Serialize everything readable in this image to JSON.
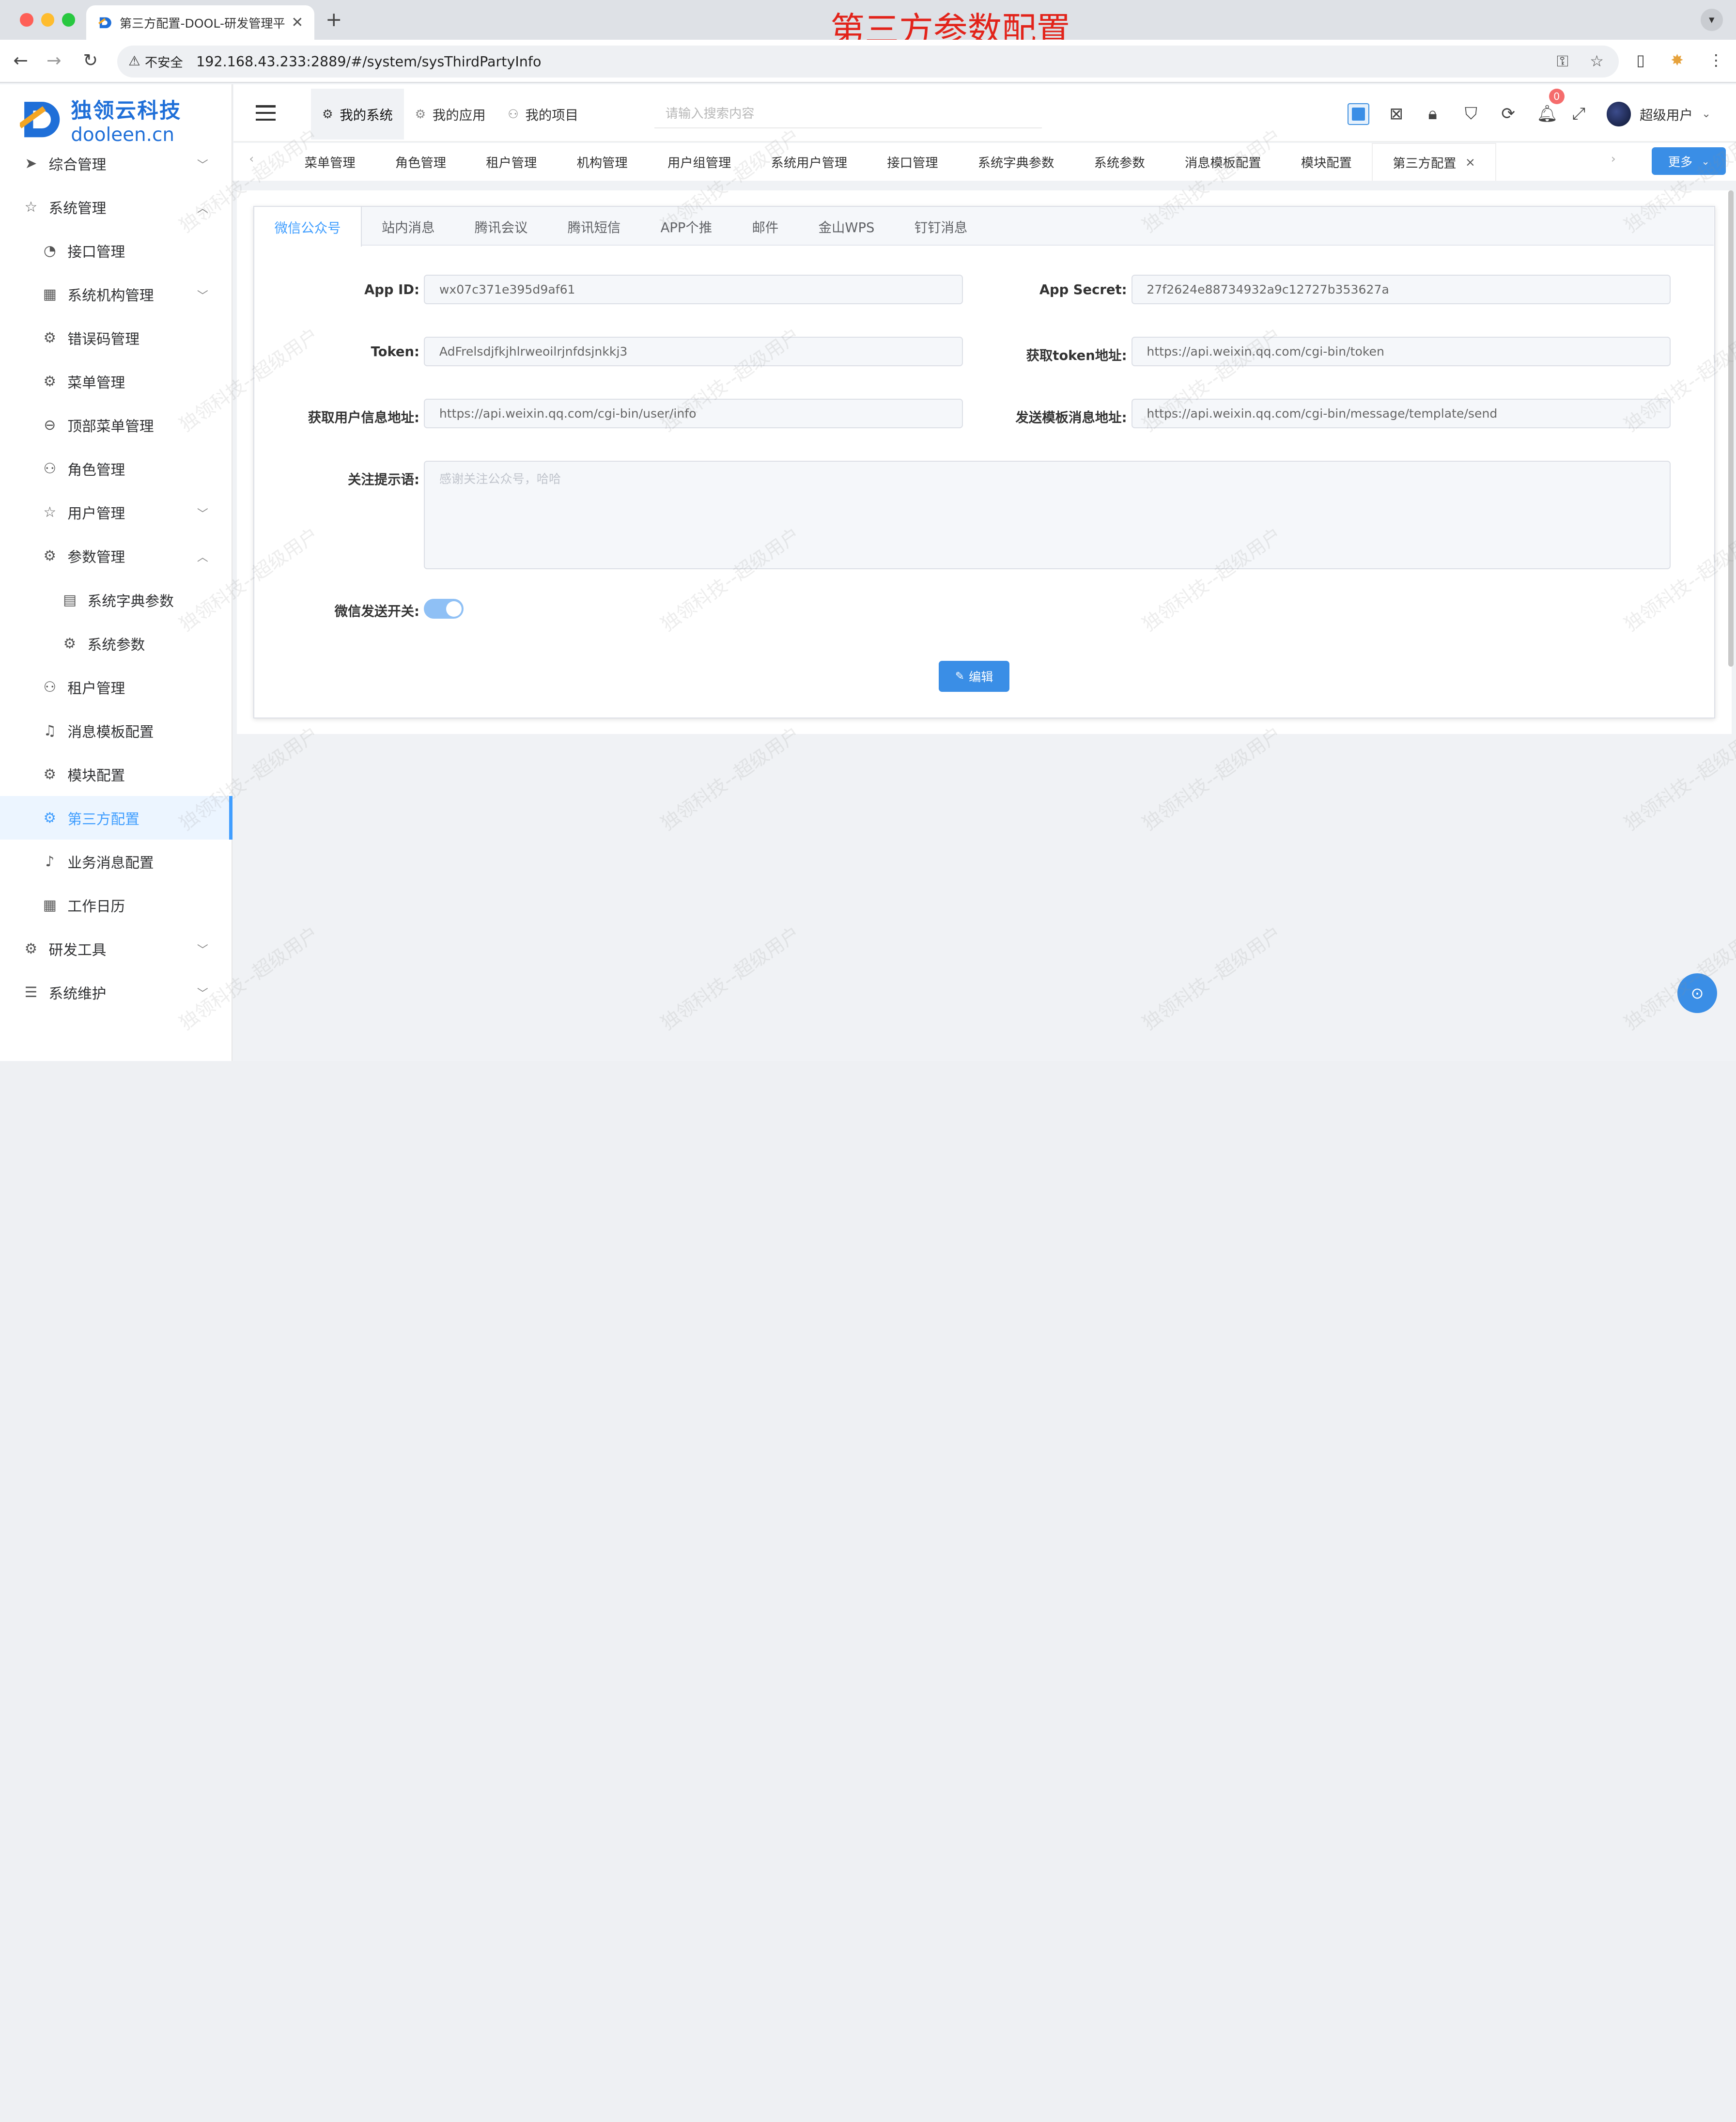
{
  "overlay_title": "第三方参数配置",
  "browser": {
    "tab_title": "第三方配置-DOOL-研发管理平",
    "security_label": "不安全",
    "url": "192.168.43.233:2889/#/system/sysThirdPartyInfo"
  },
  "logo": {
    "cn": "独领云科技",
    "en": "dooleen.cn"
  },
  "sidebar": {
    "items": [
      {
        "label": "综合管理",
        "icon": "send-icon",
        "level": 1,
        "arrow": "down"
      },
      {
        "label": "系统管理",
        "icon": "star-icon",
        "level": 1,
        "arrow": "up"
      },
      {
        "label": "接口管理",
        "icon": "gauge-icon",
        "level": 2
      },
      {
        "label": "系统机构管理",
        "icon": "grid-icon",
        "level": 2,
        "arrow": "down"
      },
      {
        "label": "错误码管理",
        "icon": "gear-icon",
        "level": 2
      },
      {
        "label": "菜单管理",
        "icon": "settings-icon",
        "level": 2
      },
      {
        "label": "顶部菜单管理",
        "icon": "zoom-out-icon",
        "level": 2
      },
      {
        "label": "角色管理",
        "icon": "user-icon",
        "level": 2
      },
      {
        "label": "用户管理",
        "icon": "star-icon",
        "level": 2,
        "arrow": "down"
      },
      {
        "label": "参数管理",
        "icon": "settings-icon",
        "level": 2,
        "arrow": "up"
      },
      {
        "label": "系统字典参数",
        "icon": "document-icon",
        "level": 3
      },
      {
        "label": "系统参数",
        "icon": "settings-icon",
        "level": 3
      },
      {
        "label": "租户管理",
        "icon": "user-icon",
        "level": 2
      },
      {
        "label": "消息模板配置",
        "icon": "bell-filled-icon",
        "level": 2
      },
      {
        "label": "模块配置",
        "icon": "settings-icon",
        "level": 2
      },
      {
        "label": "第三方配置",
        "icon": "settings-icon",
        "level": 2,
        "active": true
      },
      {
        "label": "业务消息配置",
        "icon": "bell-icon",
        "level": 2
      },
      {
        "label": "工作日历",
        "icon": "calendar-icon",
        "level": 2
      },
      {
        "label": "研发工具",
        "icon": "settings-icon",
        "level": 1,
        "arrow": "down"
      },
      {
        "label": "系统维护",
        "icon": "sliders-icon",
        "level": 1,
        "arrow": "down"
      }
    ]
  },
  "header": {
    "nav": [
      {
        "label": "我的系统",
        "icon": "gear-icon",
        "active": true
      },
      {
        "label": "我的应用",
        "icon": "settings-icon"
      },
      {
        "label": "我的项目",
        "icon": "user-icon"
      }
    ],
    "search_placeholder": "请输入搜索内容",
    "notification_count": "0",
    "user_name": "超级用户"
  },
  "tags": {
    "items": [
      {
        "label": "菜单管理"
      },
      {
        "label": "角色管理"
      },
      {
        "label": "租户管理"
      },
      {
        "label": "机构管理"
      },
      {
        "label": "用户组管理"
      },
      {
        "label": "系统用户管理"
      },
      {
        "label": "接口管理"
      },
      {
        "label": "系统字典参数"
      },
      {
        "label": "系统参数"
      },
      {
        "label": "消息模板配置"
      },
      {
        "label": "模块配置"
      },
      {
        "label": "第三方配置",
        "active": true,
        "closable": true
      }
    ],
    "more_label": "更多"
  },
  "card": {
    "tabs": [
      {
        "label": "微信公众号",
        "active": true
      },
      {
        "label": "站内消息"
      },
      {
        "label": "腾讯会议"
      },
      {
        "label": "腾讯短信"
      },
      {
        "label": "APP个推"
      },
      {
        "label": "邮件"
      },
      {
        "label": "金山WPS"
      },
      {
        "label": "钉钉消息"
      }
    ],
    "form": {
      "app_id": {
        "label": "App ID:",
        "value": "wx07c371e395d9af61"
      },
      "app_secret": {
        "label": "App Secret:",
        "value": "27f2624e88734932a9c12727b353627a"
      },
      "token": {
        "label": "Token:",
        "value": "AdFrelsdjfkjhlrweoilrjnfdsjnkkj3"
      },
      "token_url": {
        "label": "获取token地址:",
        "value": "https://api.weixin.qq.com/cgi-bin/token"
      },
      "userinfo_url": {
        "label": "获取用户信息地址:",
        "value": "https://api.weixin.qq.com/cgi-bin/user/info"
      },
      "template_url": {
        "label": "发送模板消息地址:",
        "value": "https://api.weixin.qq.com/cgi-bin/message/template/send"
      },
      "follow_tip": {
        "label": "关注提示语:",
        "placeholder": "感谢关注公众号，哈哈"
      },
      "send_switch": {
        "label": "微信发送开关:",
        "on": true
      }
    },
    "edit_label": "编辑"
  },
  "watermark_text": "独领科技--超级用户",
  "colors": {
    "accent": "#409eff",
    "primary_button": "#3a8ee6",
    "brand": "#1f6fd8",
    "title_red": "#e2231a"
  }
}
